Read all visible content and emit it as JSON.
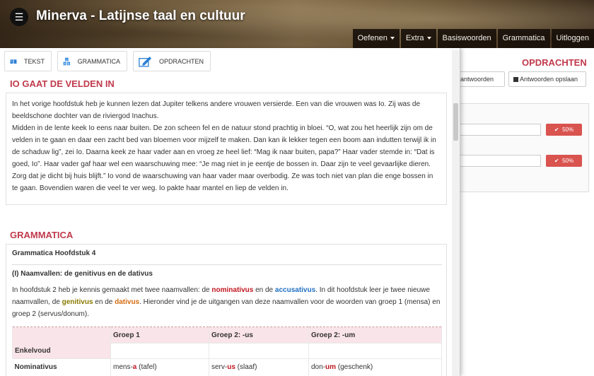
{
  "header": {
    "title": "Minerva - Latijnse taal en cultuur",
    "menu_icon": "hamburger-icon",
    "nav": [
      {
        "label": "Oefenen",
        "dropdown": true
      },
      {
        "label": "Extra",
        "dropdown": true
      },
      {
        "label": "Basiswoorden",
        "dropdown": false
      },
      {
        "label": "Grammatica",
        "dropdown": false
      },
      {
        "label": "Uitloggen",
        "dropdown": false
      }
    ]
  },
  "right_panel": {
    "title": "OPDRACHTEN",
    "check_btn": "nt antwoorden",
    "save_btn": "Antwoorden opslaan",
    "save_icon": "floppy-disk-icon",
    "scores": [
      "50%",
      "50%"
    ],
    "check_icon": "checkmark-icon"
  },
  "tabs": [
    {
      "label": "TEKST",
      "icon": "book-icon"
    },
    {
      "label": "GRAMMATICA",
      "icon": "abc-blocks-icon"
    },
    {
      "label": "OPDRACHTEN",
      "icon": "pen-edit-icon"
    }
  ],
  "text_section": {
    "title": "IO GAAT DE VELDEN IN",
    "paragraph1": "In het vorige hoofdstuk heb je kunnen lezen dat Jupiter telkens andere vrouwen versierde. Een van die vrouwen was Io. Zij was de beeldschone dochter van de riviergod Inachus.",
    "paragraph2": "Midden in de lente keek Io eens naar buiten. De zon scheen fel en de natuur stond prachtig in bloei. “O, wat zou het heerlijk zijn om de velden in te gaan en daar een zacht bed van bloemen voor mijzelf te maken. Dan kan ik lekker tegen een boom aan indutten terwijl ik in de schaduw lig”, zei Io. Daarna keek ze haar vader aan en vroeg ze heel lief: “Mag ik naar buiten, papa?” Haar vader stemde in: “Dat is goed, Io”. Haar vader gaf haar wel een waarschuwing mee: “Je mag niet in je eentje de bossen in. Daar zijn te veel gevaarlijke dieren. Zorg dat je dicht bij huis blijft.” Io vond de waarschuwing van haar vader maar overbodig. Ze was toch niet van plan die enge bossen in te gaan. Bovendien waren die veel te ver weg. Io pakte haar mantel en liep de velden in."
  },
  "grammar_section": {
    "title": "GRAMMATICA",
    "chapter": "Grammatica Hoofdstuk 4",
    "subtitle": "(I) Naamvallen: de genitivus en de dativus",
    "intro": {
      "p1": "In hoofdstuk 2 heb je kennis gemaakt met twee naamvallen: de ",
      "nominativus": "nominativus",
      "p2": " en de ",
      "accusativus": "accusativus",
      "p3": ". In dit hoofdstuk leer je twee nieuwe naamvallen, de ",
      "genitivus": "genitivus",
      "p4": " en de ",
      "dativus": "dativus",
      "p5": ". Hieronder vind je de uitgangen van deze naamvallen voor de woorden van groep 1 (mensa) en groep 2 (servus/donum)."
    },
    "table": {
      "corner": "Enkelvoud",
      "headers": [
        "Groep 1",
        "Groep 2: -us",
        "Groep 2: -um"
      ],
      "rows": [
        {
          "case": "Nominativus",
          "cells": [
            {
              "stem": "mens-",
              "ending": "a",
              "gloss": " (tafel)"
            },
            {
              "stem": "serv-",
              "ending": "us",
              "gloss": " (slaaf)"
            },
            {
              "stem": "don-",
              "ending": "um",
              "gloss": " (geschenk)"
            }
          ]
        }
      ]
    }
  },
  "colors": {
    "accent_red": "#c0394b",
    "nominativus": "#c0161f",
    "accusativus": "#1f6fc1",
    "genitivus": "#8a7a00",
    "dativus": "#d46c12",
    "table_header_bg": "#f9e4ea",
    "badge_red": "#d9534f"
  }
}
